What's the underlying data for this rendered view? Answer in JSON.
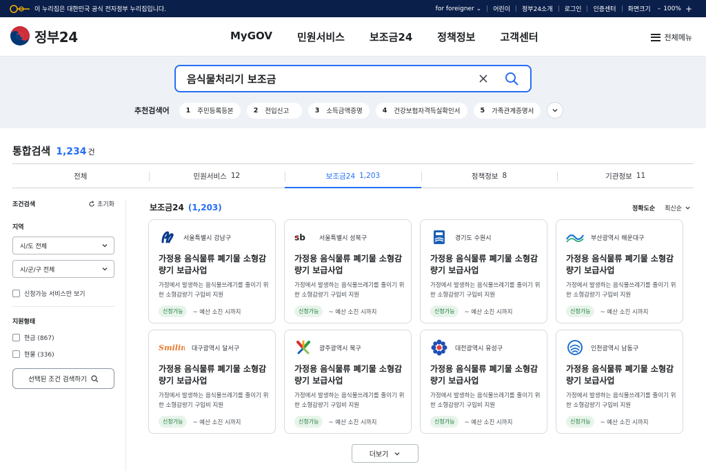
{
  "topbar": {
    "notice": "이 누리집은 대한민국 공식 전자정부 누리집입니다.",
    "links": [
      "for foreigner",
      "어린이",
      "정부24소개",
      "로그인",
      "인증센터"
    ],
    "zoom_label": "화면크기",
    "zoom_value": "100%"
  },
  "header": {
    "logo_text": "정부24",
    "nav": [
      "MyGOV",
      "민원서비스",
      "보조금24",
      "정책정보",
      "고객센터"
    ],
    "all_menu": "전체메뉴"
  },
  "search": {
    "query": "음식물처리기 보조금",
    "recommend_title": "추천검색어",
    "recommend": [
      {
        "no": "1",
        "label": "주민등록등본"
      },
      {
        "no": "2",
        "label": "전입신고"
      },
      {
        "no": "3",
        "label": "소득금액증명"
      },
      {
        "no": "4",
        "label": "건강보험자격득실확인서"
      },
      {
        "no": "5",
        "label": "가족관계증명서"
      }
    ]
  },
  "results": {
    "title": "통합검색",
    "count": "1,234",
    "unit": "건",
    "tabs": [
      {
        "label": "전체",
        "count": ""
      },
      {
        "label": "민원서비스",
        "count": "12"
      },
      {
        "label": "보조금24",
        "count": "1,203"
      },
      {
        "label": "정책정보",
        "count": "8"
      },
      {
        "label": "기관정보",
        "count": "11"
      }
    ]
  },
  "sidebar": {
    "title": "조건검색",
    "reset": "초기화",
    "region_label": "지역",
    "sido": "시/도 전체",
    "sigungu": "시/군/구 전체",
    "only_available": "신청가능 서비스만 보기",
    "support_label": "지원형태",
    "support_options": [
      "현금 (867)",
      "현물 (336)"
    ],
    "search_button": "선택된 조건 검색하기"
  },
  "list": {
    "title": "보조금24",
    "count": "(1,203)",
    "sort": [
      "정확도순",
      "최신순"
    ],
    "more": "더보기",
    "cards": [
      {
        "org": "서울특별시 강남구",
        "title": "가정용 음식물류 폐기물 소형감량기 보급사업",
        "desc": "가정에서 발생하는 음식물쓰레기를 줄이기 위한 소형감량기 구입비 지원",
        "status": "신청가능",
        "period": "~ 예산 소진 시까지"
      },
      {
        "org": "서울특별시 성북구",
        "title": "가정용 음식물류 폐기물 소형감량기 보급사업",
        "desc": "가정에서 발생하는 음식물쓰레기를 줄이기 위한 소형감량기 구입비 지원",
        "status": "신청가능",
        "period": "~ 예산 소진 시까지"
      },
      {
        "org": "경기도 수원시",
        "title": "가정용 음식물류 폐기물 소형감량기 보급사업",
        "desc": "가정에서 발생하는 음식물쓰레기를 줄이기 위한 소형감량기 구입비 지원",
        "status": "신청가능",
        "period": "~ 예산 소진 시까지"
      },
      {
        "org": "부산광역시 해운대구",
        "title": "가정용 음식물류 폐기물 소형감량기 보급사업",
        "desc": "가정에서 발생하는 음식물쓰레기를 줄이기 위한 소형감량기 구입비 지원",
        "status": "신청가능",
        "period": "~ 예산 소진 시까지"
      },
      {
        "org": "대구광역시 달서구",
        "title": "가정용 음식물류 폐기물 소형감량기 보급사업",
        "desc": "가정에서 발생하는 음식물쓰레기를 줄이기 위한 소형감량기 구입비 지원",
        "status": "신청가능",
        "period": "~ 예산 소진 시까지"
      },
      {
        "org": "광주광역시 북구",
        "title": "가정용 음식물류 폐기물 소형감량기 보급사업",
        "desc": "가정에서 발생하는 음식물쓰레기를 줄이기 위한 소형감량기 구입비 지원",
        "status": "신청가능",
        "period": "~ 예산 소진 시까지"
      },
      {
        "org": "대전광역시 유성구",
        "title": "가정용 음식물류 폐기물 소형감량기 보급사업",
        "desc": "가정에서 발생하는 음식물쓰레기를 줄이기 위한 소형감량기 구입비 지원",
        "status": "신청가능",
        "period": "~ 예산 소진 시까지"
      },
      {
        "org": "인천광역시 남동구",
        "title": "가정용 음식물류 폐기물 소형감량기 보급사업",
        "desc": "가정에서 발생하는 음식물쓰레기를 줄이기 위한 소형감량기 구입비 지원",
        "status": "신청가능",
        "period": "~ 예산 소진 시까지"
      }
    ]
  },
  "colors": {
    "primary": "#256ef4",
    "navy": "#0b1f4b",
    "badge_bg": "#e7f4ea",
    "badge_text": "#1a7a3a"
  }
}
